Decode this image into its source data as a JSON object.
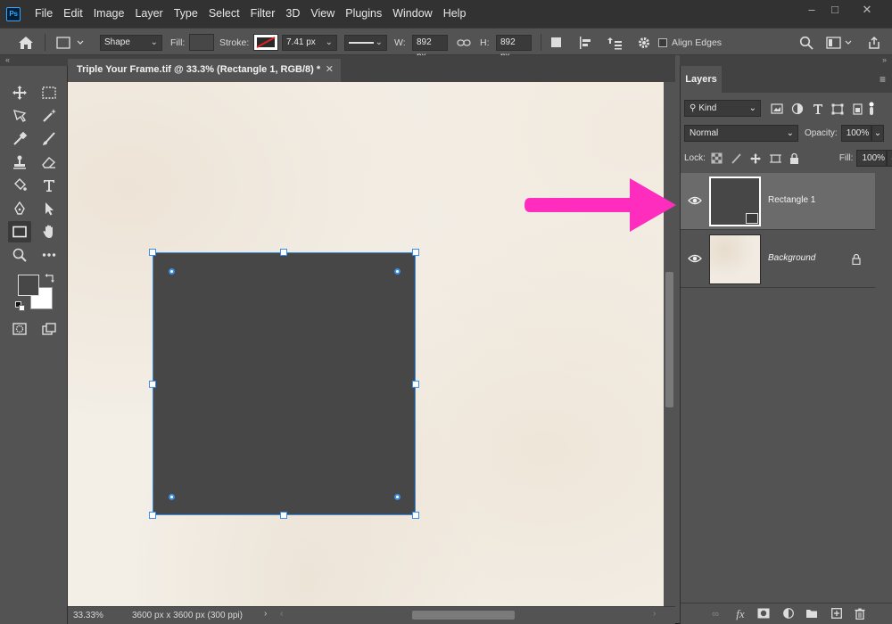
{
  "app": {
    "logo": "Ps"
  },
  "menu": [
    "File",
    "Edit",
    "Image",
    "Layer",
    "Type",
    "Select",
    "Filter",
    "3D",
    "View",
    "Plugins",
    "Window",
    "Help"
  ],
  "options": {
    "mode": "Shape",
    "fill_label": "Fill:",
    "stroke_label": "Stroke:",
    "stroke_width": "7.41 px",
    "w_label": "W:",
    "w_value": "892 px",
    "h_label": "H:",
    "h_value": "892 px",
    "align_edges": "Align Edges"
  },
  "document": {
    "tab_title": "Triple Your Frame.tif @ 33.3% (Rectangle 1, RGB/8) *",
    "zoom": "33.33%",
    "doc_info": "3600 px x 3600 px (300 ppi)"
  },
  "layers_panel": {
    "tab": "Layers",
    "filter_kind": "Kind",
    "blend_mode": "Normal",
    "opacity_label": "Opacity:",
    "opacity": "100%",
    "lock_label": "Lock:",
    "fill_label": "Fill:",
    "fill": "100%",
    "layers": [
      {
        "name": "Rectangle 1",
        "selected": true,
        "visible": true
      },
      {
        "name": "Background",
        "selected": false,
        "visible": true,
        "locked": true
      }
    ]
  },
  "colors": {
    "foreground": "#474747",
    "background": "#ffffff",
    "selection": "#3a8ee6",
    "annotation_arrow": "#ff2dbd"
  }
}
